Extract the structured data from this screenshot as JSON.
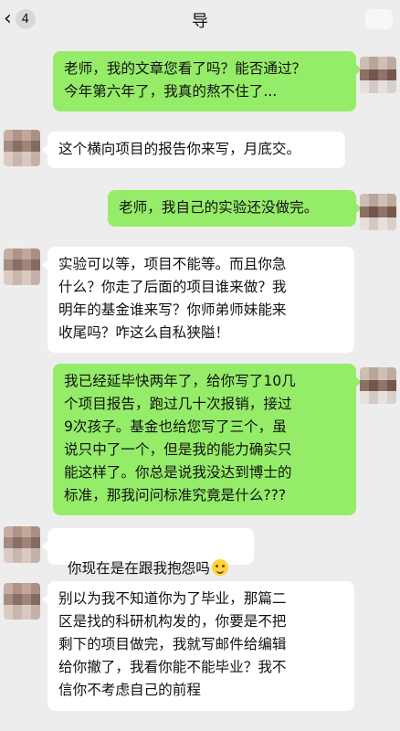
{
  "header": {
    "back_count": "4",
    "title": "导"
  },
  "messages": [
    {
      "side": "right",
      "text": "老师，我的文章您看了吗？能否通过？\n今年第六年了，我真的熬不住了..."
    },
    {
      "side": "left",
      "text": "这个横向项目的报告你来写，月底交。"
    },
    {
      "side": "right",
      "text": "老师，我自己的实验还没做完。"
    },
    {
      "side": "left",
      "text": "实验可以等，项目不能等。而且你急\n什么？你走了后面的项目谁来做？我\n明年的基金谁来写？你师弟师妹能来\n收尾吗？咋这么自私狭隘！"
    },
    {
      "side": "right",
      "text": "我已经延毕快两年了，给你写了10几\n个项目报告，跑过几十次报销，接过\n9次孩子。基金也给您写了三个，虽\n说只中了一个，但是我的能力确实只\n能这样了。你总是说我没达到博士的\n标准，那我问问标准究竟是什么???"
    },
    {
      "side": "left",
      "text": "你现在是在跟我抱怨吗",
      "emoji": "smiling-face"
    },
    {
      "side": "left",
      "text": "别以为我不知道你为了毕业，那篇二\n区是找的科研机构发的，你要是不把\n剩下的项目做完，我就写邮件给编辑\n给你撤了，我看你能不能毕业？我不\n信你不考虑自己的前程"
    }
  ],
  "icons": {
    "back": "chevron-left-icon",
    "more": "more-icon",
    "emoji": "smiling-face-emoji-icon"
  },
  "colors": {
    "background": "#ededed",
    "outgoing_bubble": "#95ec69",
    "incoming_bubble": "#ffffff"
  }
}
